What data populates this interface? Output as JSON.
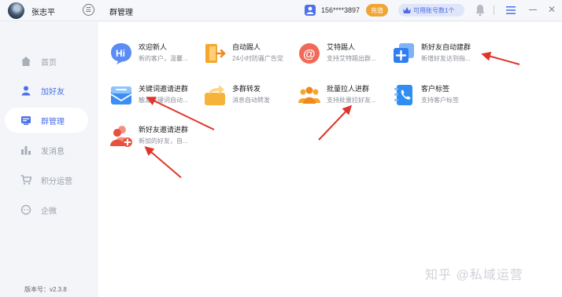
{
  "header": {
    "username": "张志平",
    "page_title": "群管理",
    "phone": "156****3897",
    "recharge_label": "充值",
    "account_badge": "可用账号数1个"
  },
  "sidebar": {
    "items": [
      {
        "label": "首页",
        "icon": "home-icon"
      },
      {
        "label": "加好友",
        "icon": "person-icon"
      },
      {
        "label": "群管理",
        "icon": "group-manage-icon"
      },
      {
        "label": "发消息",
        "icon": "bar-chart-icon"
      },
      {
        "label": "积分运营",
        "icon": "cart-icon"
      },
      {
        "label": "企微",
        "icon": "chat-icon"
      }
    ],
    "selected_index": 2,
    "version": "版本号：v2.3.8"
  },
  "cards": [
    {
      "title": "欢迎新人",
      "desc": "新的客户，温馨...",
      "icon": "hi-bubble-icon"
    },
    {
      "title": "自动踢人",
      "desc": "24小时防骚广告党",
      "icon": "exit-door-icon"
    },
    {
      "title": "艾特踢人",
      "desc": "支持艾特踢出群...",
      "icon": "at-sign-icon"
    },
    {
      "title": "新好友自动建群",
      "desc": "新增好友达到指...",
      "icon": "add-group-icon"
    },
    {
      "title": "关键词邀请进群",
      "desc": "触发关键词自动...",
      "icon": "mail-box-icon"
    },
    {
      "title": "多群转发",
      "desc": "消息自动转发",
      "icon": "forward-icon"
    },
    {
      "title": "批量拉人进群",
      "desc": "支持批量拉好友...",
      "icon": "people-group-icon"
    },
    {
      "title": "客户标签",
      "desc": "支持客户标签",
      "icon": "phone-book-icon"
    },
    {
      "title": "新好友邀请进群",
      "desc": "新加的好友，自...",
      "icon": "add-person-icon"
    }
  ],
  "watermark": "知乎 @私域运营",
  "colors": {
    "accent": "#4b70ea",
    "recharge": "#f0a534",
    "arrow": "#e0352b"
  }
}
